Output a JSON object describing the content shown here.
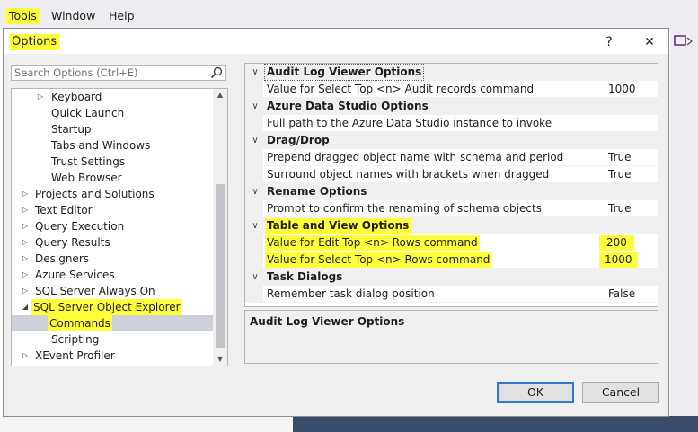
{
  "menubar": {
    "items": [
      "Tools",
      "Window",
      "Help"
    ]
  },
  "dialog": {
    "title": "Options",
    "help_glyph": "?",
    "close_glyph": "✕"
  },
  "search": {
    "placeholder": "Search Options (Ctrl+E)",
    "value": ""
  },
  "tree": {
    "items": [
      {
        "label": "Keyboard",
        "arrow": "▷"
      },
      {
        "label": "Quick Launch",
        "arrow": ""
      },
      {
        "label": "Startup",
        "arrow": ""
      },
      {
        "label": "Tabs and Windows",
        "arrow": ""
      },
      {
        "label": "Trust Settings",
        "arrow": ""
      },
      {
        "label": "Web Browser",
        "arrow": ""
      },
      {
        "label": "Projects and Solutions",
        "arrow": "▷"
      },
      {
        "label": "Text Editor",
        "arrow": "▷"
      },
      {
        "label": "Query Execution",
        "arrow": "▷"
      },
      {
        "label": "Query Results",
        "arrow": "▷"
      },
      {
        "label": "Designers",
        "arrow": "▷"
      },
      {
        "label": "Azure Services",
        "arrow": "▷"
      },
      {
        "label": "SQL Server Always On",
        "arrow": "▷"
      },
      {
        "label": "SQL Server Object Explorer",
        "arrow": "◢"
      },
      {
        "label": "Commands",
        "arrow": ""
      },
      {
        "label": "Scripting",
        "arrow": ""
      },
      {
        "label": "XEvent Profiler",
        "arrow": "▷"
      }
    ]
  },
  "grid": {
    "categories": [
      {
        "label": "Audit Log Viewer Options",
        "rows": [
          {
            "name": "Value for Select Top <n> Audit records command",
            "value": "1000"
          }
        ]
      },
      {
        "label": "Azure Data Studio Options",
        "rows": [
          {
            "name": "Full path to the Azure Data Studio instance to invoke",
            "value": ""
          }
        ]
      },
      {
        "label": "Drag/Drop",
        "rows": [
          {
            "name": "Prepend dragged object name with schema and period",
            "value": "True"
          },
          {
            "name": "Surround object names with brackets when dragged",
            "value": "True"
          }
        ]
      },
      {
        "label": "Rename Options",
        "rows": [
          {
            "name": "Prompt to confirm the renaming of schema objects",
            "value": "True"
          }
        ]
      },
      {
        "label": "Table and View Options",
        "rows": [
          {
            "name": "Value for Edit Top <n> Rows command",
            "value": "200"
          },
          {
            "name": "Value for Select Top <n> Rows command",
            "value": "1000"
          }
        ]
      },
      {
        "label": "Task Dialogs",
        "rows": [
          {
            "name": "Remember task dialog position",
            "value": "False"
          }
        ]
      }
    ],
    "chevron_glyph": "∨"
  },
  "description": {
    "title": "Audit Log Viewer Options"
  },
  "buttons": {
    "ok": "OK",
    "cancel": "Cancel"
  },
  "colors": {
    "highlight": "#ffff3a",
    "selection": "#cdd0d9",
    "ok_border": "#2b78d6"
  }
}
